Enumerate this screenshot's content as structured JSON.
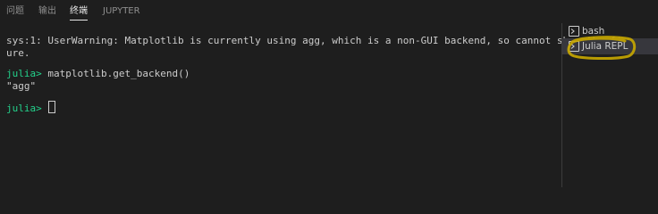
{
  "tabs": [
    {
      "label": "问题"
    },
    {
      "label": "输出"
    },
    {
      "label": "终端"
    },
    {
      "label": "JUPYTER"
    }
  ],
  "active_tab": "终端",
  "terminal": {
    "line1": "sys:1: UserWarning: Matplotlib is currently using agg, which is a non-GUI backend, so cannot show the fig",
    "line2": "ure.",
    "prompt": "julia>",
    "command": " matplotlib.get_backend()",
    "output": "\"agg\"",
    "prompt2": "julia>"
  },
  "terminal_list": [
    {
      "label": "bash",
      "icon": "terminal-icon"
    },
    {
      "label": "Julia REPL",
      "icon": "terminal-icon"
    }
  ],
  "selected_terminal": "Julia REPL",
  "colors": {
    "background": "#1e1e1e",
    "prompt": "#23d18b",
    "annotation": "#c9a800"
  }
}
